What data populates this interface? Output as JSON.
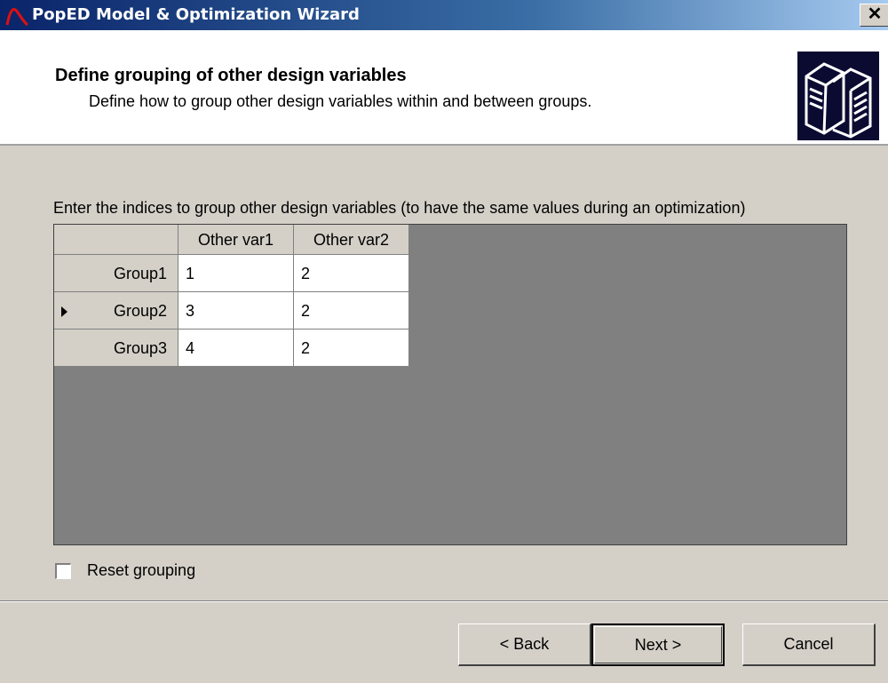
{
  "window": {
    "title": "PopED Model & Optimization Wizard",
    "close_label": "✕"
  },
  "header": {
    "title": "Define grouping of other design variables",
    "subtitle": "Define how to group other design variables within and between groups."
  },
  "instructions": "Enter the indices to group other design variables (to have the same values during an optimization)",
  "grid": {
    "columns": [
      "Other var1",
      "Other var2"
    ],
    "rows": [
      {
        "label": "Group1",
        "values": [
          "1",
          "2"
        ]
      },
      {
        "label": "Group2",
        "values": [
          "3",
          "2"
        ]
      },
      {
        "label": "Group3",
        "values": [
          "4",
          "2"
        ]
      }
    ]
  },
  "reset_label": "Reset grouping",
  "buttons": {
    "back": "< Back",
    "next": "Next >",
    "cancel": "Cancel"
  },
  "colors": {
    "title_bar": "#0a246a",
    "grid_bg": "#808080",
    "dialog_bg": "#d4d0c8"
  }
}
